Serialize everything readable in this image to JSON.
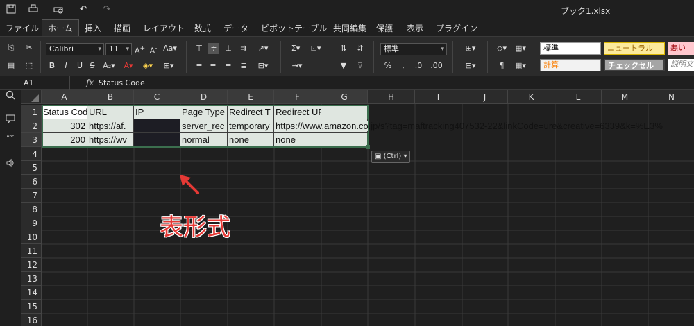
{
  "window": {
    "title": "ブック1.xlsx"
  },
  "titlebar_icons": [
    "save-icon",
    "print-icon",
    "print-preview-icon",
    "undo-icon",
    "redo-icon"
  ],
  "tabs": [
    "ファイル",
    "ホーム",
    "挿入",
    "描画",
    "レイアウト",
    "数式",
    "データ",
    "ピボットテーブル",
    "共同編集",
    "保護",
    "表示",
    "プラグイン"
  ],
  "ribbon": {
    "font_name": "Calibri",
    "font_size": "11",
    "number_format": "標準",
    "styles": [
      {
        "label": "標準",
        "bg": "#ffffff",
        "fg": "#000000"
      },
      {
        "label": "ニュートラル",
        "bg": "#fdeb9c",
        "fg": "#9c6500"
      },
      {
        "label": "悪い",
        "bg": "#ffc7ce",
        "fg": "#9c0006"
      },
      {
        "label": "計算",
        "bg": "#f2f2f2",
        "fg": "#fa7d00"
      },
      {
        "label": "チェックセル",
        "bg": "#a5a5a5",
        "fg": "#ffffff"
      },
      {
        "label": "説明文",
        "bg": "#ffffff",
        "fg": "#7f7f7f"
      }
    ]
  },
  "formula_bar": {
    "cell_ref": "A1",
    "fx": "fx",
    "content": "Status Code"
  },
  "columns": [
    "A",
    "B",
    "C",
    "D",
    "E",
    "F",
    "G",
    "H",
    "I",
    "J",
    "K",
    "L",
    "M",
    "N"
  ],
  "rows": [
    "1",
    "2",
    "3",
    "4",
    "5",
    "6",
    "7",
    "8",
    "9",
    "10",
    "11",
    "12",
    "13",
    "14",
    "15",
    "16"
  ],
  "cells": {
    "r1": [
      "Status Cod",
      "URL",
      "IP",
      "Page Type",
      "Redirect T",
      "Redirect URL",
      ""
    ],
    "r2": [
      "302",
      "https://af.",
      "",
      "server_rec",
      "temporary",
      "https://www.amazon.co.jp/s?tag=maftracking407532-22&linkCode=ure&creative=6339&k=%E3%"
    ],
    "r3": [
      "200",
      "https://wv",
      "",
      "normal",
      "none",
      "none",
      ""
    ]
  },
  "paste_button": {
    "label": "(Ctrl)"
  },
  "annotation": "表形式",
  "colors": {
    "accent": "#e53935",
    "selection": "#dfe6e0"
  }
}
